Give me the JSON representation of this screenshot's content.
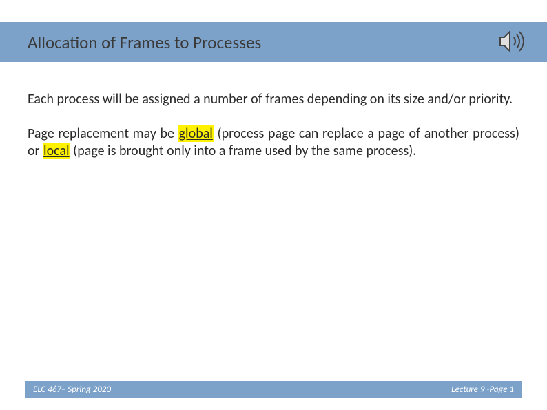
{
  "title": "Allocation of Frames to Processes",
  "para1": "Each process will be assigned a number of frames depending on its size and/or priority.",
  "para2_a": "Page replacement may be ",
  "hl_global": "global",
  "para2_b": " (process page can replace a page of another process) or ",
  "hl_local": "local",
  "para2_c": " (page is brought only into a frame used by the same process).",
  "footer_left": "ELC 467– Spring 2020",
  "footer_right": "Lecture 9 -Page 1"
}
